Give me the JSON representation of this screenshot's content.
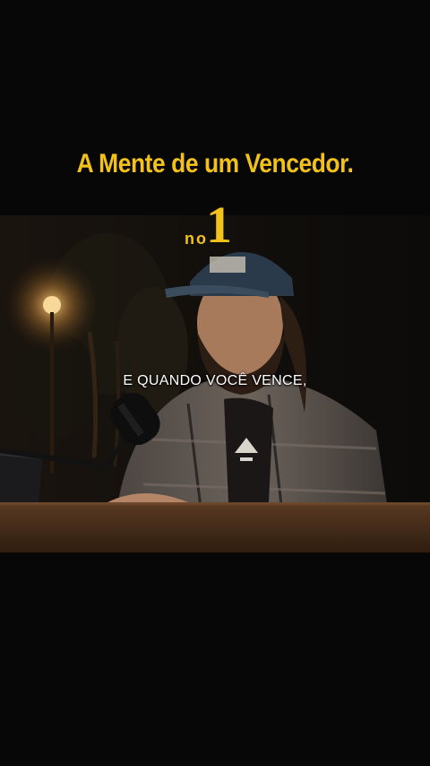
{
  "header": {
    "title": "A Mente de um Vencedor."
  },
  "logo": {
    "prefix": "no",
    "number": "1",
    "icon": "number-one-logo-icon"
  },
  "video": {
    "caption": "E QUANDO VOCÊ VENCE,"
  },
  "colors": {
    "background": "#070707",
    "accent": "#F2C21A",
    "caption": "#FFFFFF"
  }
}
